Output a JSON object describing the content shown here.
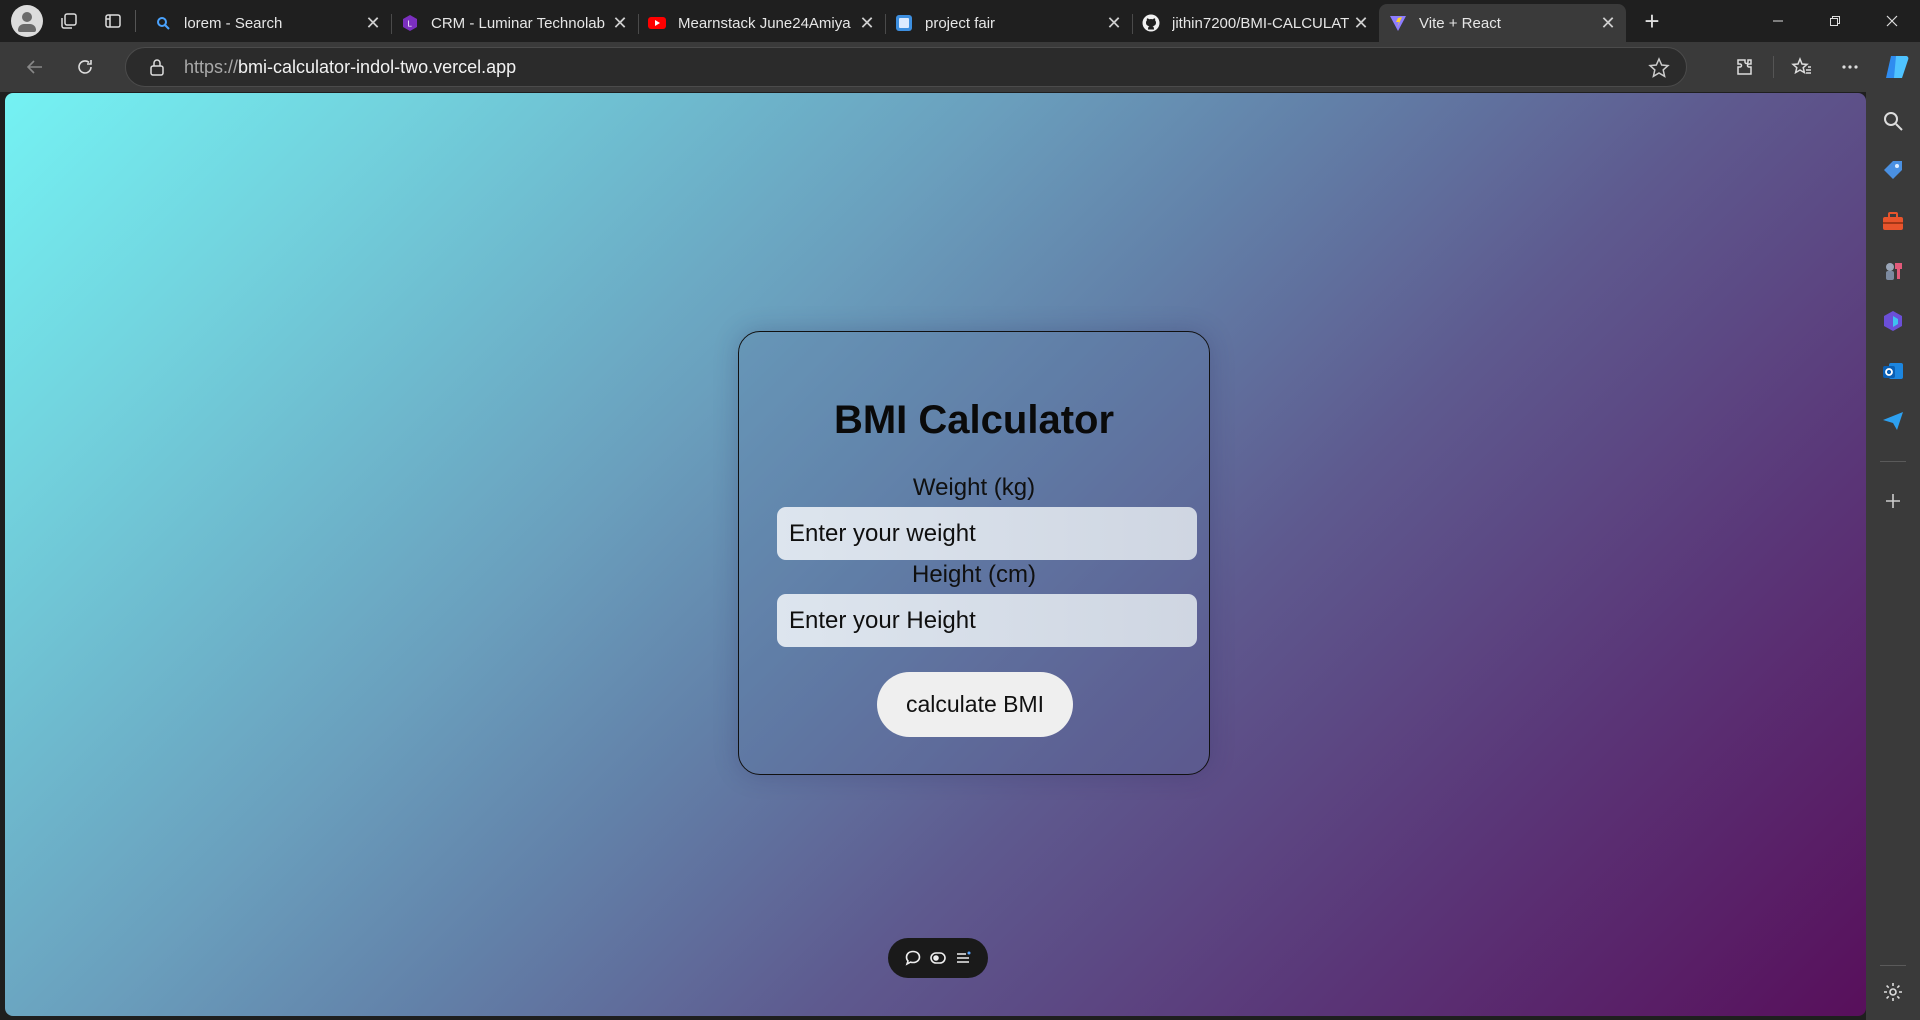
{
  "tabs": [
    {
      "title": "lorem - Search",
      "favicon": "search-icon",
      "active": false
    },
    {
      "title": "CRM - Luminar Technolab",
      "favicon": "luminar-hex-icon",
      "active": false
    },
    {
      "title": "Mearnstack June24Amiya",
      "favicon": "youtube-icon",
      "active": false
    },
    {
      "title": "project fair",
      "favicon": "page-icon",
      "active": false
    },
    {
      "title": "jithin7200/BMI-CALCULAT",
      "favicon": "github-icon",
      "active": false
    },
    {
      "title": "Vite + React",
      "favicon": "vite-icon",
      "active": true
    }
  ],
  "address_bar": {
    "protocol": "https://",
    "host": "bmi-calculator-indol-two.vercel.app"
  },
  "sidebar_icons": [
    "search-icon",
    "tag-icon",
    "toolbox-icon",
    "games-icon",
    "copilot-icon",
    "outlook-icon",
    "send-icon",
    "add-icon",
    "settings-icon"
  ],
  "page": {
    "title": "BMI Calculator",
    "weight": {
      "label": "Weight (kg)",
      "placeholder": "Enter your weight",
      "value": ""
    },
    "height": {
      "label": "Height (cm)",
      "placeholder": "Enter your Height",
      "value": ""
    },
    "button_label": "calculate BMI"
  },
  "floating_toolbar": [
    "comment-icon",
    "view-icon",
    "menu-icon"
  ],
  "colors": {
    "gradient_start": "#74f2f3",
    "gradient_end": "#580f5b",
    "browser_frame": "#3a3a3a"
  }
}
